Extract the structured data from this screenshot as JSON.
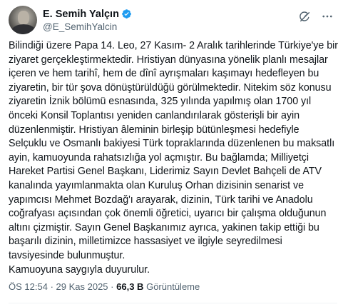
{
  "author": {
    "display_name": "E. Semih Yalçın",
    "handle": "@E_SemihYalcin",
    "verified": true,
    "verified_color": "#1d9bf0"
  },
  "actions": {
    "grok_icon": "grok-icon",
    "more_icon": "more-icon"
  },
  "tweet": {
    "text": "Bilindiği üzere Papa 14. Leo, 27 Kasım- 2 Aralık tarihlerinde Türkiye'ye bir ziyaret gerçekleştirmektedir. Hristiyan dünyasına yönelik planlı mesajlar içeren ve hem tarihî, hem de dînî ayrışmaları kaşımayı hedefleyen bu ziyaretin, bir tür şova dönüştürüldüğü görülmektedir. Nitekim söz konusu ziyaretin İznik bölümü esnasında, 325 yılında yapılmış olan 1700 yıl önceki Konsil Toplantısı yeniden canlandırılarak gösterişli bir ayin düzenlenmiştir. Hristiyan âleminin birleşip bütünleşmesi hedefiyle Selçuklu ve Osmanlı bakiyesi Türk topraklarında düzenlenen bu maksatlı ayin, kamuoyunda rahatsızlığa yol açmıştır. Bu bağlamda; Milliyetçi Hareket Partisi Genel Başkanı, Liderimiz Sayın Devlet Bahçeli de ATV kanalında yayımlanmakta olan Kuruluş Orhan dizisinin senarist ve yapımcısı Mehmet Bozdağ'ı arayarak, dizinin, Türk tarihi ve Anadolu coğrafyası açısından çok önemli öğretici, uyarıcı bir çalışma olduğunun altını çizmiştir. Sayın Genel Başkanımız ayrıca, yakinen takip ettiği bu başarılı dizinin, milletimizce hassasiyet ve ilgiyle seyredilmesi tavsiyesinde bulunmuştur.\nKamuoyuna saygıyla duyurulur."
  },
  "meta": {
    "time": "ÖS 12:54",
    "separator": "·",
    "date": "29 Kas 2025",
    "views_count": "66,3 B",
    "views_label": "Görüntüleme"
  }
}
